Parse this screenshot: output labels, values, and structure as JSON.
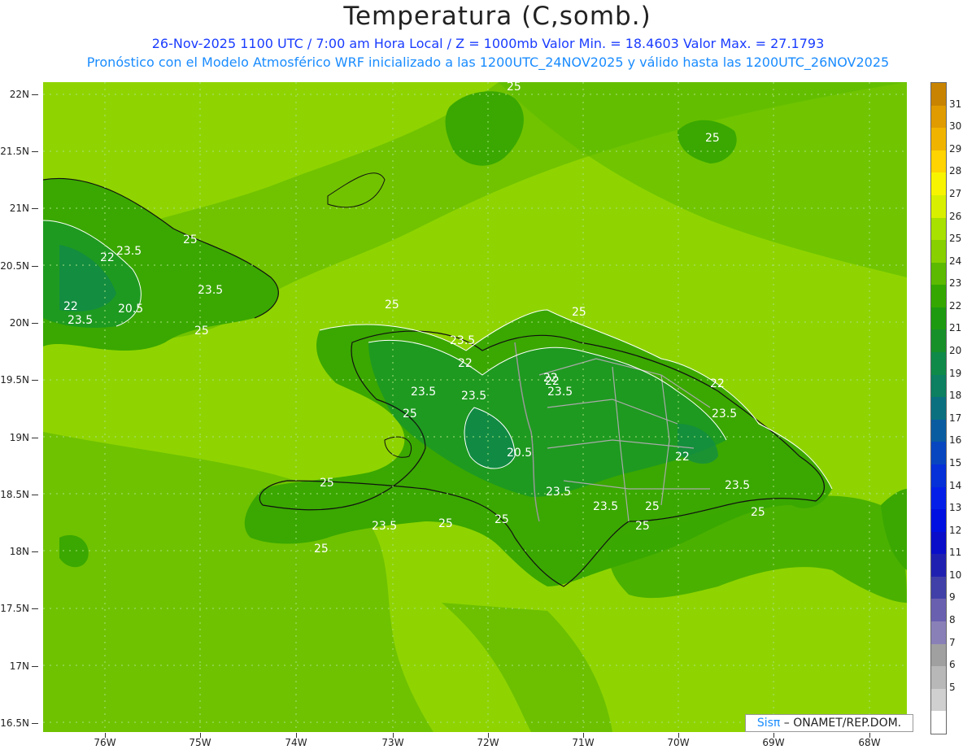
{
  "header": {
    "title": "Temperatura (C,somb.)",
    "subtitle_line1": "26-Nov-2025  1100 UTC / 7:00 am Hora Local / Z = 1000mb   Valor Min. = 18.4603  Valor Max. = 27.1793",
    "subtitle_line2": "Pronóstico con el Modelo Atmosférico WRF inicializado a las 1200UTC_24NOV2025 y válido hasta las  1200UTC_26NOV2025"
  },
  "map": {
    "lat_labels": [
      "22N",
      "21.5N",
      "21N",
      "20.5N",
      "20N",
      "19.5N",
      "19N",
      "18.5N",
      "18N",
      "17.5N",
      "17N",
      "16.5N"
    ],
    "lon_labels": [
      "76W",
      "75W",
      "74W",
      "73W",
      "72W",
      "71W",
      "70W",
      "69W",
      "68W"
    ],
    "contour_labels": [
      {
        "text": "25"
      },
      {
        "text": "25"
      },
      {
        "text": "25"
      },
      {
        "text": "23.5"
      },
      {
        "text": "22"
      },
      {
        "text": "22"
      },
      {
        "text": "20.5"
      },
      {
        "text": "23.5"
      },
      {
        "text": "23.5"
      },
      {
        "text": "25"
      },
      {
        "text": "25"
      },
      {
        "text": "25"
      },
      {
        "text": "23.5"
      },
      {
        "text": "22"
      },
      {
        "text": "22"
      },
      {
        "text": "23.5"
      },
      {
        "text": "25"
      },
      {
        "text": "23.5"
      },
      {
        "text": "22"
      },
      {
        "text": "23.5"
      },
      {
        "text": "22"
      },
      {
        "text": "23.5"
      },
      {
        "text": "20.5"
      },
      {
        "text": "22"
      },
      {
        "text": "23.5"
      },
      {
        "text": "25"
      },
      {
        "text": "23.5"
      },
      {
        "text": "23.5"
      },
      {
        "text": "25"
      },
      {
        "text": "25"
      },
      {
        "text": "23.5"
      },
      {
        "text": "25"
      },
      {
        "text": "25"
      },
      {
        "text": "25"
      },
      {
        "text": "25"
      }
    ],
    "credit_sis": "Sisπ",
    "credit_rest": " – ONAMET/REP.DOM."
  },
  "colorbar": {
    "labels": [
      "31",
      "30",
      "29",
      "28",
      "27",
      "26",
      "25",
      "24",
      "23",
      "22",
      "21",
      "20",
      "19",
      "18",
      "17",
      "16",
      "15",
      "14",
      "13",
      "12",
      "11",
      "10",
      "9",
      "8",
      "7",
      "6",
      "5"
    ],
    "colors": [
      "#c88400",
      "#e09b00",
      "#f0b400",
      "#ffd400",
      "#f8f400",
      "#d8f000",
      "#a8e000",
      "#88d000",
      "#5cba00",
      "#34a800",
      "#1e9a10",
      "#18902a",
      "#108a48",
      "#0c8060",
      "#0a7080",
      "#0a5ca0",
      "#0846c0",
      "#0630d8",
      "#0420e8",
      "#0010e0",
      "#0a0ec8",
      "#2020b0",
      "#4040a8",
      "#6a60b0",
      "#8a80b8",
      "#a0a0a0",
      "#b8b8b8",
      "#d0d0d0",
      "#ffffff"
    ]
  }
}
